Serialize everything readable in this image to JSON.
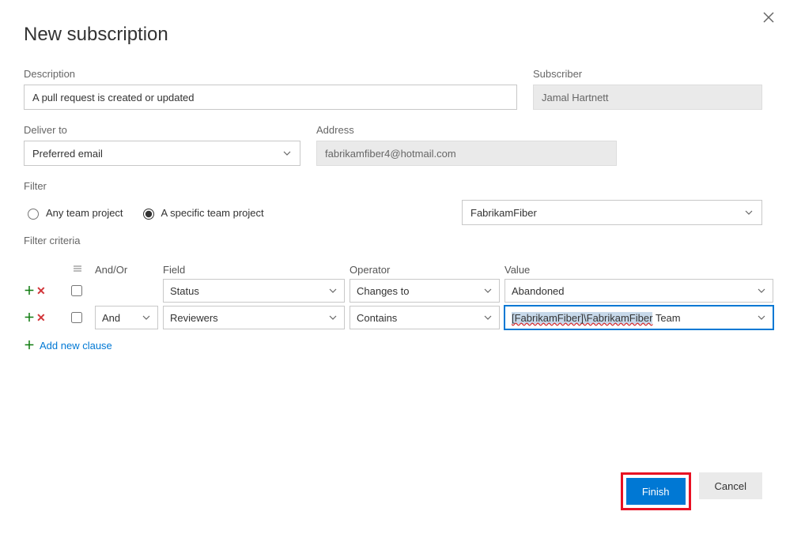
{
  "title": "New subscription",
  "labels": {
    "description": "Description",
    "subscriber": "Subscriber",
    "deliver_to": "Deliver to",
    "address": "Address",
    "filter": "Filter",
    "filter_criteria": "Filter criteria"
  },
  "description_value": "A pull request is created or updated",
  "subscriber_value": "Jamal Hartnett",
  "deliver_to_value": "Preferred email",
  "address_value": "fabrikamfiber4@hotmail.com",
  "filter": {
    "any_label": "Any team project",
    "specific_label": "A specific team project",
    "project_value": "FabrikamFiber"
  },
  "criteria": {
    "headers": {
      "andor": "And/Or",
      "field": "Field",
      "operator": "Operator",
      "value": "Value"
    },
    "rows": [
      {
        "andor": "",
        "field": "Status",
        "operator": "Changes to",
        "value": "Abandoned"
      },
      {
        "andor": "And",
        "field": "Reviewers",
        "operator": "Contains",
        "value_parts": [
          "[FabrikamFiber]\\FabrikamFiber",
          " Team"
        ]
      }
    ],
    "add_new": "Add new clause"
  },
  "buttons": {
    "finish": "Finish",
    "cancel": "Cancel"
  }
}
